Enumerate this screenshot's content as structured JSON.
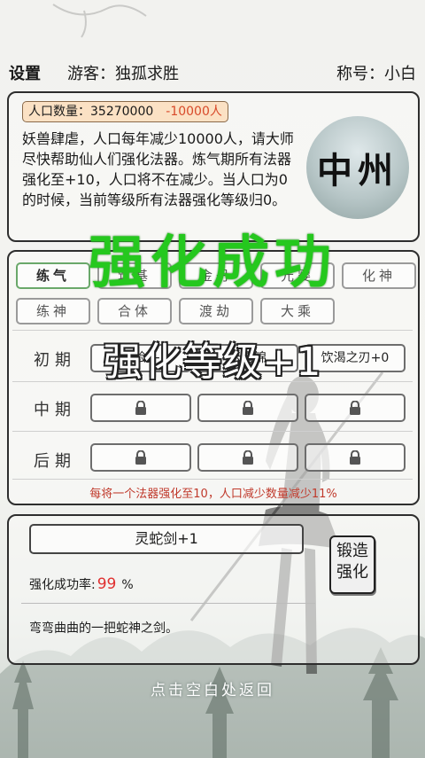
{
  "header": {
    "settings_label": "设置",
    "guest_text": "游客：独孤求胜",
    "title_text": "称号：小白"
  },
  "population": {
    "label": "人口数量：",
    "value": "35270000",
    "delta": "-10000人"
  },
  "intro_text": "妖兽肆虐，人口每年减少10000人，请大师尽快帮助仙人们强化法器。炼气期所有法器强化至+10，人口将不在减少。当人口为0的时候，当前等级所有法器强化等级归0。",
  "region_name": "中州",
  "stage_tabs": [
    {
      "label": "练气",
      "active": true
    },
    {
      "label": "筑基",
      "active": false
    },
    {
      "label": "金丹",
      "active": false
    },
    {
      "label": "元婴",
      "active": false
    },
    {
      "label": "化神",
      "active": false
    },
    {
      "label": "练神",
      "active": false
    },
    {
      "label": "合体",
      "active": false
    },
    {
      "label": "渡劫",
      "active": false
    },
    {
      "label": "大乘",
      "active": false
    }
  ],
  "rows": [
    {
      "label": "初期",
      "slots": [
        "灵蛇剑+1",
        "云雾锦",
        "饮渴之刃+0"
      ]
    },
    {
      "label": "中期",
      "slots": [
        "locked",
        "locked",
        "locked"
      ]
    },
    {
      "label": "后期",
      "slots": [
        "locked",
        "locked",
        "locked"
      ]
    }
  ],
  "stage_note": "每将一个法器强化至10，人口减少数量减少11%",
  "forge": {
    "weapon_name": "灵蛇剑+1",
    "success_rate_label": "强化成功率:",
    "success_rate_value": "99",
    "success_rate_unit": "%",
    "button_label": "锻造强化",
    "description": "弯弯曲曲的一把蛇神之剑。"
  },
  "overlay": {
    "result_text": "强化成功",
    "level_text": "强化等级+1"
  },
  "hint": "点击空白处返回",
  "colors": {
    "success_green": "#25c81e",
    "rate_red": "#e03030",
    "note_red": "#c0392b",
    "delta_red": "#d84a2a"
  }
}
